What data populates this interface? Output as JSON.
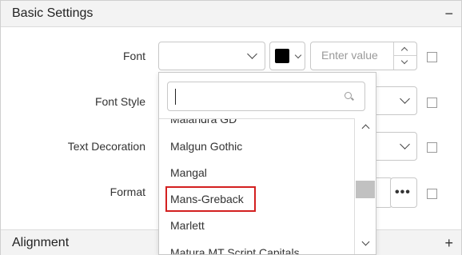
{
  "basic_settings": {
    "title": "Basic Settings",
    "toggle": "−"
  },
  "rows": {
    "font": {
      "label": "Font"
    },
    "font_style": {
      "label": "Font Style"
    },
    "text_decoration": {
      "label": "Text Decoration"
    },
    "format": {
      "label": "Format",
      "browse_label": "•••"
    }
  },
  "color_picker": {
    "value": "#000000"
  },
  "numeric": {
    "placeholder": "Enter value"
  },
  "font_dropdown": {
    "search_value": "",
    "items": [
      "Malandra GD",
      "Malgun Gothic",
      "Mangal",
      "Mans-Greback",
      "Marlett",
      "Matura MT Script Capitals"
    ],
    "selected": "Mans-Greback"
  },
  "alignment": {
    "title": "Alignment",
    "toggle": "+"
  }
}
